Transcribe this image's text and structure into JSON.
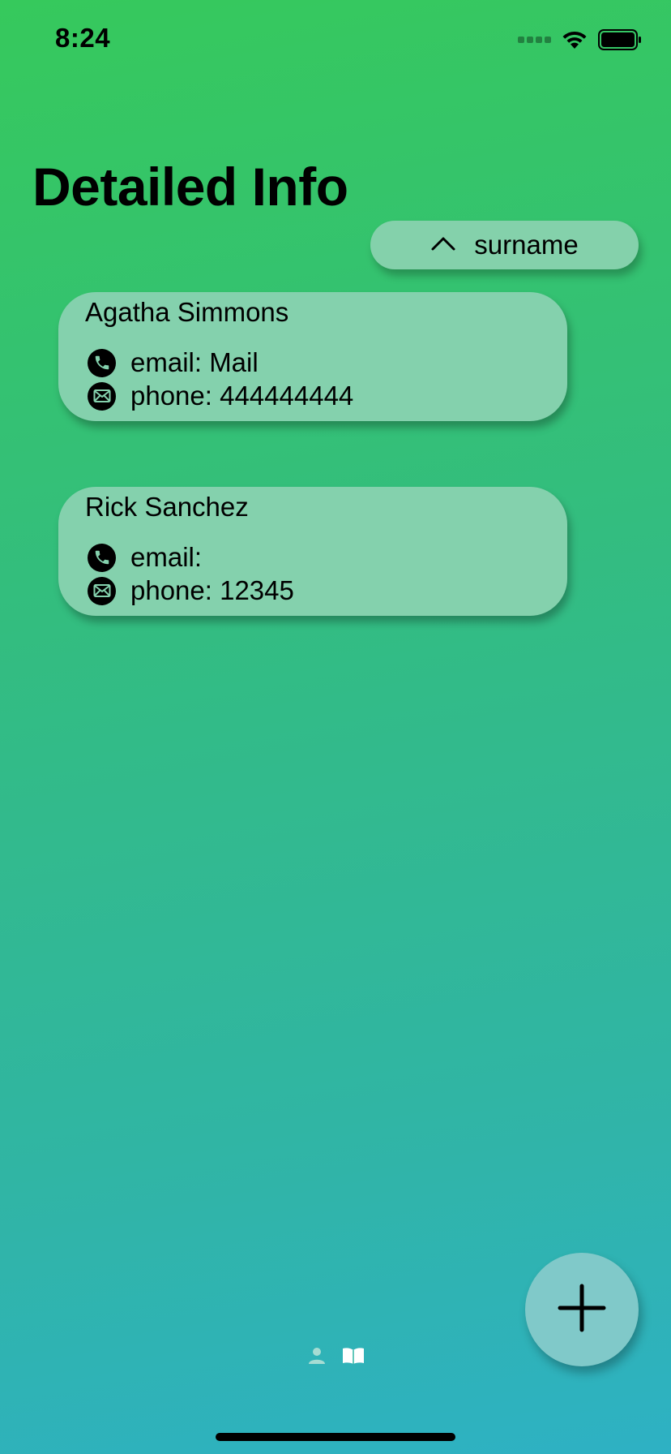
{
  "status_bar": {
    "time": "8:24"
  },
  "header": {
    "title": "Detailed Info"
  },
  "sort": {
    "label": "surname",
    "direction_icon": "chevron-up-icon"
  },
  "contacts": [
    {
      "name": "Agatha Simmons",
      "email_line": "email: Mail",
      "phone_line": "phone: 444444444"
    },
    {
      "name": "Rick Sanchez",
      "email_line": "email:",
      "phone_line": "phone: 12345"
    }
  ],
  "tabs": [
    {
      "icon": "person-icon",
      "selected": false
    },
    {
      "icon": "book-icon",
      "selected": true
    }
  ],
  "fab": {
    "icon": "plus-icon"
  },
  "colors": {
    "gradient_top": "#36c95c",
    "gradient_bottom": "#2eb1c4",
    "card_fill": "#84d1ad",
    "fab_fill": "#80c9c9"
  }
}
